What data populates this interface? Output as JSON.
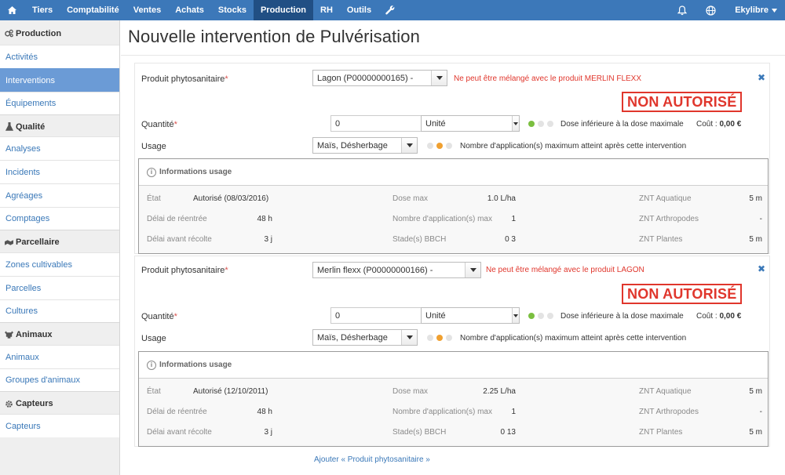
{
  "nav": {
    "home_icon": "home-icon",
    "items": [
      {
        "label": "Tiers"
      },
      {
        "label": "Comptabilité"
      },
      {
        "label": "Ventes"
      },
      {
        "label": "Achats"
      },
      {
        "label": "Stocks"
      },
      {
        "label": "Production",
        "active": true
      },
      {
        "label": "RH"
      },
      {
        "label": "Outils"
      }
    ],
    "wrench_icon": "wrench-icon",
    "bell_icon": "bell-icon",
    "globe_icon": "globe-icon",
    "user_label": "Ekylibre",
    "accent_color": "#3c78b9",
    "active_color": "#214f84"
  },
  "sidebar": {
    "sections": [
      {
        "title": "Production",
        "icon": "gears-icon",
        "items": [
          {
            "label": "Activités"
          },
          {
            "label": "Interventions",
            "active": true
          },
          {
            "label": "Équipements"
          }
        ]
      },
      {
        "title": "Qualité",
        "icon": "flask-icon",
        "items": [
          {
            "label": "Analyses"
          },
          {
            "label": "Incidents"
          },
          {
            "label": "Agréages"
          },
          {
            "label": "Comptages"
          }
        ]
      },
      {
        "title": "Parcellaire",
        "icon": "map-icon",
        "items": [
          {
            "label": "Zones cultivables"
          },
          {
            "label": "Parcelles"
          },
          {
            "label": "Cultures"
          }
        ]
      },
      {
        "title": "Animaux",
        "icon": "cow-icon",
        "items": [
          {
            "label": "Animaux"
          },
          {
            "label": "Groupes d'animaux"
          }
        ]
      },
      {
        "title": "Capteurs",
        "icon": "gear-icon",
        "items": [
          {
            "label": "Capteurs"
          }
        ]
      }
    ]
  },
  "page": {
    "title": "Nouvelle intervention de Pulvérisation"
  },
  "products": [
    {
      "product_label": "Produit phytosanitaire",
      "required_mark": "*",
      "product_value": "Lagon (P00000000165) -",
      "warning": "Ne peut être mélangé avec le produit MERLIN FLEXX",
      "status_stamp": "NON AUTORISÉ",
      "quantity_label": "Quantité",
      "quantity_value": "0",
      "unit_value": "Unité",
      "dose_note": "Dose inférieure à la dose maximale",
      "cost_label": "Coût :",
      "cost_value": "0,00 €",
      "usage_label": "Usage",
      "usage_value": "Maïs, Désherbage",
      "usage_note": "Nombre d'application(s) maximum atteint après cette intervention",
      "info": {
        "title": "Informations usage",
        "etat_label": "État",
        "etat_value": "Autorisé (08/03/2016)",
        "reentry_label": "Délai de réentrée",
        "reentry_value": "48 h",
        "preharvest_label": "Délai avant récolte",
        "preharvest_value": "3 j",
        "dose_max_label": "Dose max",
        "dose_max_value": "1.0 L/ha",
        "nb_app_label": "Nombre d'application(s) max",
        "nb_app_value": "1",
        "bbch_label": "Stade(s) BBCH",
        "bbch_value": "0 3",
        "znt_aqua_label": "ZNT Aquatique",
        "znt_aqua_value": "5 m",
        "znt_arthro_label": "ZNT Arthropodes",
        "znt_arthro_value": "-",
        "znt_plantes_label": "ZNT Plantes",
        "znt_plantes_value": "5 m"
      }
    },
    {
      "product_label": "Produit phytosanitaire",
      "required_mark": "*",
      "product_value": "Merlin flexx (P00000000166) -",
      "warning": "Ne peut être mélangé avec le produit LAGON",
      "status_stamp": "NON AUTORISÉ",
      "quantity_label": "Quantité",
      "quantity_value": "0",
      "unit_value": "Unité",
      "dose_note": "Dose inférieure à la dose maximale",
      "cost_label": "Coût :",
      "cost_value": "0,00 €",
      "usage_label": "Usage",
      "usage_value": "Maïs, Désherbage",
      "usage_note": "Nombre d'application(s) maximum atteint après cette intervention",
      "info": {
        "title": "Informations usage",
        "etat_label": "État",
        "etat_value": "Autorisé (12/10/2011)",
        "reentry_label": "Délai de réentrée",
        "reentry_value": "48 h",
        "preharvest_label": "Délai avant récolte",
        "preharvest_value": "3 j",
        "dose_max_label": "Dose max",
        "dose_max_value": "2.25 L/ha",
        "nb_app_label": "Nombre d'application(s) max",
        "nb_app_value": "1",
        "bbch_label": "Stade(s) BBCH",
        "bbch_value": "0 13",
        "znt_aqua_label": "ZNT Aquatique",
        "znt_aqua_value": "5 m",
        "znt_arthro_label": "ZNT Arthropodes",
        "znt_arthro_value": "-",
        "znt_plantes_label": "ZNT Plantes",
        "znt_plantes_value": "5 m"
      }
    }
  ],
  "add_link": "Ajouter « Produit phytosanitaire »",
  "colors": {
    "error": "#e0362c",
    "link": "#3a78b8",
    "dot_green": "#7bbf40",
    "dot_orange": "#f0a030"
  }
}
